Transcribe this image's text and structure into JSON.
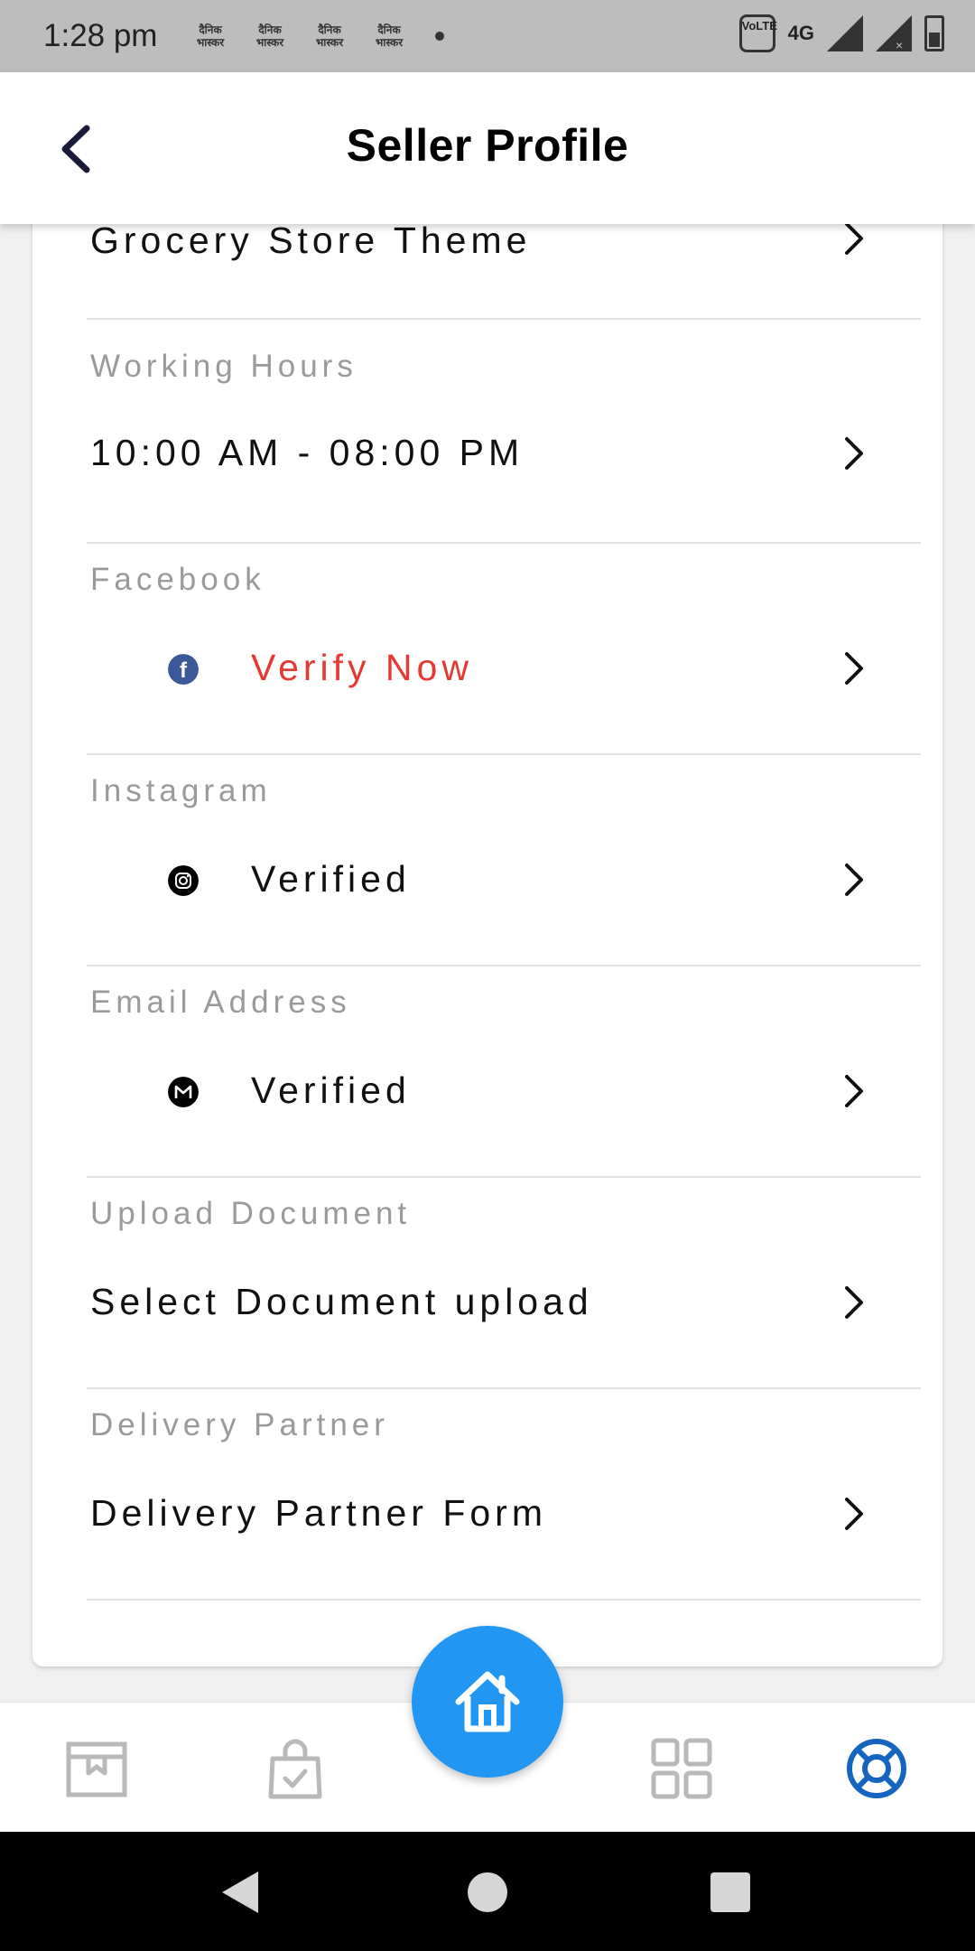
{
  "status_bar": {
    "time": "1:28 pm",
    "notification_apps": [
      "दैनिक भास्कर",
      "दैनिक भास्कर",
      "दैनिक भास्कर",
      "दैनिक भास्कर"
    ],
    "volte": "VoLTE",
    "network": "4G"
  },
  "header": {
    "title": "Seller Profile",
    "back_icon": "chevron-left-icon"
  },
  "profile_items": [
    {
      "label": "",
      "value": "Grocery Store Theme"
    },
    {
      "label": "Working Hours",
      "value": "10:00 AM - 08:00 PM"
    },
    {
      "label": "Facebook",
      "value": "Verify Now",
      "icon": "facebook-icon",
      "value_color": "#e53935"
    },
    {
      "label": "Instagram",
      "value": "Verified",
      "icon": "instagram-icon"
    },
    {
      "label": "Email Address",
      "value": "Verified",
      "icon": "gmail-icon"
    },
    {
      "label": "Upload Document",
      "value": "Select Document upload"
    },
    {
      "label": "Delivery Partner",
      "value": "Delivery Partner Form"
    }
  ],
  "bottom_nav": {
    "items": [
      "store-icon",
      "orders-bag-icon",
      "home-icon",
      "categories-grid-icon",
      "support-lifebuoy-icon"
    ],
    "active": "support-lifebuoy-icon"
  },
  "colors": {
    "accent": "#2196f3",
    "active_nav": "#1565c0",
    "warning": "#e53935"
  }
}
